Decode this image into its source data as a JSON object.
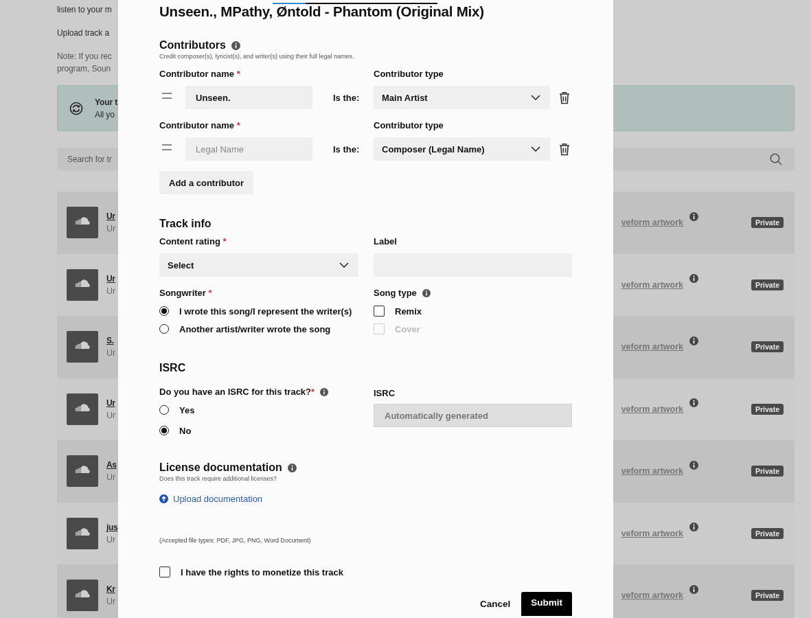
{
  "background": {
    "intro_lines": [
      "listen to your m",
      "Upload track a"
    ],
    "note_lines": [
      "Note: If you rec",
      "program, Soun"
    ],
    "banner": {
      "title": "Your t",
      "text": "All yo"
    },
    "search": {
      "placeholder": "Search for tr"
    },
    "tracks": [
      {
        "title": "Ur",
        "subtitle": "Ur",
        "link": "veform artwork",
        "badge": "Private"
      },
      {
        "title": "Ur",
        "subtitle": "Ur",
        "link": "veform artwork",
        "badge": "Private"
      },
      {
        "title": "S.",
        "subtitle": "Ur",
        "link": "veform artwork",
        "badge": "Private"
      },
      {
        "title": "Ur",
        "subtitle": "Ur",
        "link": "veform artwork",
        "badge": "Private"
      },
      {
        "title": "As",
        "subtitle": "Ur",
        "link": "veform artwork",
        "badge": "Private"
      },
      {
        "title": "jus",
        "subtitle": "Ur",
        "link": "veform artwork",
        "badge": "Private"
      },
      {
        "title": "Kr",
        "subtitle": "Ur",
        "link": "veform artwork",
        "badge": "Private"
      }
    ]
  },
  "modal": {
    "title": "Unseen., MPathy, Øntold - Phantom (Original Mix)",
    "contributors": {
      "heading": "Contributors",
      "subtitle": "Credit composer(s), lyricist(s), and writer(s) using their full legal names.",
      "rows": [
        {
          "name_label": "Contributor name",
          "required_mark": "*",
          "value": "Unseen.",
          "is_label": "Is the:",
          "type_label": "Contributor type",
          "type_value": "Main Artist"
        },
        {
          "name_label": "Contributor name",
          "required_mark": "*",
          "placeholder": "Legal Name",
          "is_label": "Is the:",
          "type_label": "Contributor type",
          "type_value": "Composer (Legal Name)"
        }
      ],
      "add_button": "Add a contributor"
    },
    "track_info": {
      "heading": "Track info",
      "content_rating": {
        "label": "Content rating",
        "required_mark": "*",
        "value": "Select"
      },
      "label_field": {
        "label": "Label"
      },
      "songwriter": {
        "label": "Songwriter",
        "required_mark": "*",
        "options": [
          {
            "label": "I wrote this song/I represent the writer(s)",
            "selected": true
          },
          {
            "label": "Another artist/writer wrote the song",
            "selected": false
          }
        ]
      },
      "song_type": {
        "label": "Song type",
        "options": [
          {
            "label": "Remix",
            "checked": false,
            "disabled": false
          },
          {
            "label": "Cover",
            "checked": false,
            "disabled": true
          }
        ]
      }
    },
    "isrc": {
      "heading": "ISRC",
      "question": "Do you have an ISRC for this track?",
      "required_mark": "*",
      "options": [
        {
          "label": "Yes",
          "selected": false
        },
        {
          "label": "No",
          "selected": true
        }
      ],
      "field": {
        "label": "ISRC",
        "placeholder": "Automatically generated",
        "disabled": true
      }
    },
    "license": {
      "heading": "License documentation",
      "subtitle": "Does this track require additional licenses?",
      "upload_link": "Upload documentation",
      "accepted_types": "(Accepted file types: PDF, JPG, PNG, Word Document)"
    },
    "monetize": {
      "label": "I have the rights to monetize this track",
      "checked": false
    },
    "buttons": {
      "cancel": "Cancel",
      "submit": "Submit"
    }
  }
}
